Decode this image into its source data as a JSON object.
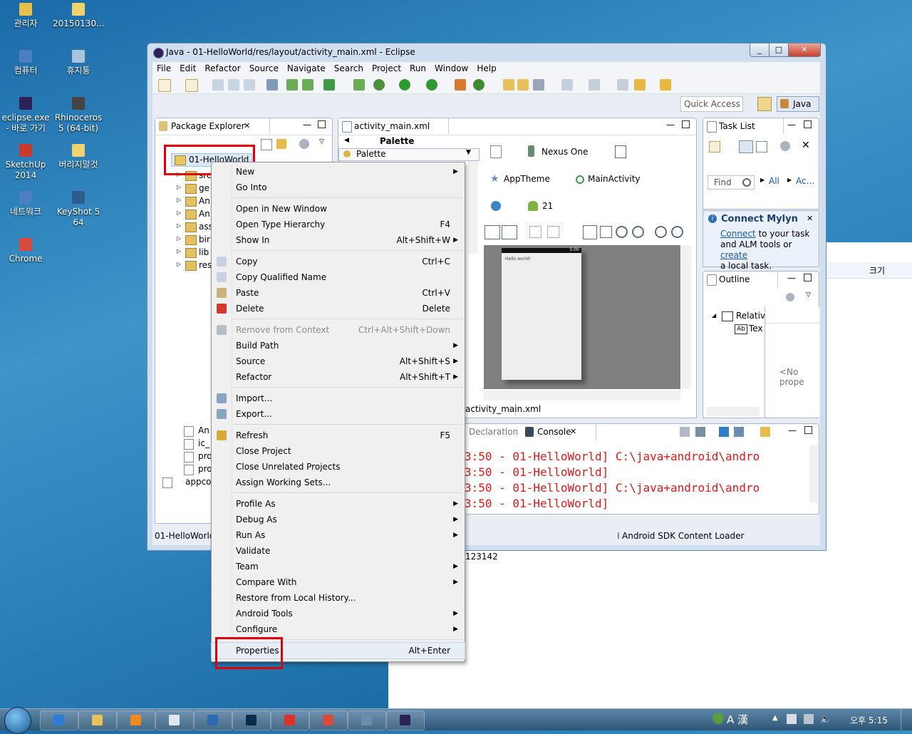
{
  "desktop": {
    "icons": [
      {
        "label": "관리자",
        "icon": "user-folder-icon",
        "color": "#e8c14a"
      },
      {
        "label": "20150130...",
        "icon": "folder-icon",
        "color": "#f1d36b"
      },
      {
        "label": "컴퓨터",
        "icon": "computer-icon",
        "color": "#4a7fc1"
      },
      {
        "label": "휴지통",
        "icon": "recycle-bin-icon",
        "color": "#a8c3da"
      },
      {
        "label": "eclipse.exe - 바로 가기",
        "icon": "eclipse-shortcut-icon",
        "color": "#2c2255"
      },
      {
        "label": "Rhinoceros 5 (64-bit)",
        "icon": "rhinoceros-icon",
        "color": "#444444"
      },
      {
        "label": "SketchUp 2014",
        "icon": "sketchup-icon",
        "color": "#c83a2a"
      },
      {
        "label": "버리지말것",
        "icon": "folder-icon",
        "color": "#f1d36b"
      },
      {
        "label": "네트워크",
        "icon": "network-icon",
        "color": "#4a7fc1"
      },
      {
        "label": "KeyShot 5 64",
        "icon": "keyshot-icon",
        "color": "#2d5d8c"
      },
      {
        "label": "Chrome",
        "icon": "chrome-icon",
        "color": "#d64b3c"
      }
    ]
  },
  "background_window": {
    "column_header": "크기",
    "lines": [
      "123142"
    ]
  },
  "eclipse": {
    "title": "Java - 01-HelloWorld/res/layout/activity_main.xml - Eclipse",
    "window_buttons": [
      "_",
      "□",
      "✕"
    ],
    "menu": [
      "File",
      "Edit",
      "Refactor",
      "Source",
      "Navigate",
      "Search",
      "Project",
      "Run",
      "Window",
      "Help"
    ],
    "quick_access": "Quick Access",
    "perspective": "Java",
    "package_explorer": {
      "tab": "Package Explorer",
      "project": "01-HelloWorld",
      "tree_items": [
        "src",
        "ge",
        "An",
        "An",
        "ass",
        "bir",
        "lib",
        "res"
      ],
      "bottom_items": [
        "An",
        "ic_",
        "pro",
        "pro",
        "appco"
      ],
      "status": "01-HelloWorld"
    },
    "editor": {
      "tab": "activity_main.xml",
      "palette_header": "Palette",
      "palette_item": "Palette",
      "device": "Nexus One",
      "theme": "AppTheme",
      "activity": "MainActivity",
      "api": "21",
      "preview_text": "Hello world!",
      "preview_clock": "5:00",
      "bottom_tab": "activity_main.xml"
    },
    "task_list": {
      "tab": "Task List",
      "find_placeholder": "Find",
      "all": "All",
      "activate": "Ac..."
    },
    "mylyn": {
      "title": "Connect Mylyn",
      "connect": "Connect",
      "text1": " to your task",
      "text2": "and ALM tools or ",
      "create": "create",
      "text3": "a local task."
    },
    "outline": {
      "tab": "Outline",
      "item1": "Relativ",
      "item2": "Tex",
      "no_props": "<No prope"
    },
    "console": {
      "tab_declaration": "Declaration",
      "tab": "Console",
      "lines": [
        "3:50 - 01-HelloWorld] C:\\java+android\\andro",
        "3:50 - 01-HelloWorld]",
        "3:50 - 01-HelloWorld] C:\\java+android\\andro",
        "3:50 - 01-HelloWorld]"
      ]
    },
    "status_bar": "Android SDK Content Loader"
  },
  "context_menu": {
    "items": [
      {
        "label": "New",
        "shortcut": "",
        "submenu": true,
        "icon": ""
      },
      {
        "label": "Go Into",
        "shortcut": "",
        "submenu": false,
        "icon": ""
      },
      {
        "sep": true
      },
      {
        "label": "Open in New Window",
        "shortcut": "",
        "submenu": false,
        "icon": ""
      },
      {
        "label": "Open Type Hierarchy",
        "shortcut": "F4",
        "submenu": false,
        "icon": ""
      },
      {
        "label": "Show In",
        "shortcut": "Alt+Shift+W",
        "submenu": true,
        "icon": ""
      },
      {
        "sep": true
      },
      {
        "label": "Copy",
        "shortcut": "Ctrl+C",
        "submenu": false,
        "icon": "copy-icon"
      },
      {
        "label": "Copy Qualified Name",
        "shortcut": "",
        "submenu": false,
        "icon": "copy-qualified-icon"
      },
      {
        "label": "Paste",
        "shortcut": "Ctrl+V",
        "submenu": false,
        "icon": "paste-icon"
      },
      {
        "label": "Delete",
        "shortcut": "Delete",
        "submenu": false,
        "icon": "delete-icon"
      },
      {
        "sep": true
      },
      {
        "label": "Remove from Context",
        "shortcut": "Ctrl+Alt+Shift+Down",
        "submenu": false,
        "icon": "remove-context-icon",
        "disabled": true
      },
      {
        "label": "Build Path",
        "shortcut": "",
        "submenu": true,
        "icon": ""
      },
      {
        "label": "Source",
        "shortcut": "Alt+Shift+S",
        "submenu": true,
        "icon": ""
      },
      {
        "label": "Refactor",
        "shortcut": "Alt+Shift+T",
        "submenu": true,
        "icon": ""
      },
      {
        "sep": true
      },
      {
        "label": "Import...",
        "shortcut": "",
        "submenu": false,
        "icon": "import-icon"
      },
      {
        "label": "Export...",
        "shortcut": "",
        "submenu": false,
        "icon": "export-icon"
      },
      {
        "sep": true
      },
      {
        "label": "Refresh",
        "shortcut": "F5",
        "submenu": false,
        "icon": "refresh-icon"
      },
      {
        "label": "Close Project",
        "shortcut": "",
        "submenu": false,
        "icon": ""
      },
      {
        "label": "Close Unrelated Projects",
        "shortcut": "",
        "submenu": false,
        "icon": ""
      },
      {
        "label": "Assign Working Sets...",
        "shortcut": "",
        "submenu": false,
        "icon": ""
      },
      {
        "sep": true
      },
      {
        "label": "Profile As",
        "shortcut": "",
        "submenu": true,
        "icon": ""
      },
      {
        "label": "Debug As",
        "shortcut": "",
        "submenu": true,
        "icon": ""
      },
      {
        "label": "Run As",
        "shortcut": "",
        "submenu": true,
        "icon": ""
      },
      {
        "label": "Validate",
        "shortcut": "",
        "submenu": false,
        "icon": ""
      },
      {
        "label": "Team",
        "shortcut": "",
        "submenu": true,
        "icon": ""
      },
      {
        "label": "Compare With",
        "shortcut": "",
        "submenu": true,
        "icon": ""
      },
      {
        "label": "Restore from Local History...",
        "shortcut": "",
        "submenu": false,
        "icon": ""
      },
      {
        "label": "Android Tools",
        "shortcut": "",
        "submenu": true,
        "icon": ""
      },
      {
        "label": "Configure",
        "shortcut": "",
        "submenu": true,
        "icon": ""
      },
      {
        "sep": true
      },
      {
        "label": "Properties",
        "shortcut": "Alt+Enter",
        "submenu": false,
        "icon": "",
        "highlighted": true
      }
    ]
  },
  "taskbar": {
    "apps": [
      {
        "icon": "internet-explorer-icon",
        "color": "#2b7ed6"
      },
      {
        "icon": "file-explorer-icon",
        "color": "#e9c15b"
      },
      {
        "icon": "media-player-icon",
        "color": "#f08a1e"
      },
      {
        "icon": "notepad-icon",
        "color": "#dfe6ee"
      },
      {
        "icon": "keyshot-icon",
        "color": "#2d6bb0"
      },
      {
        "icon": "photoshop-icon",
        "color": "#0b2b4d"
      },
      {
        "icon": "app-red-icon",
        "color": "#e0302a"
      },
      {
        "icon": "chrome-icon",
        "color": "#d64b3c"
      },
      {
        "icon": "remote-desktop-icon",
        "color": "#6a8db0"
      },
      {
        "icon": "eclipse-icon",
        "color": "#2c2255"
      }
    ],
    "ime": "A 漢",
    "clock": "오후 5:15"
  }
}
